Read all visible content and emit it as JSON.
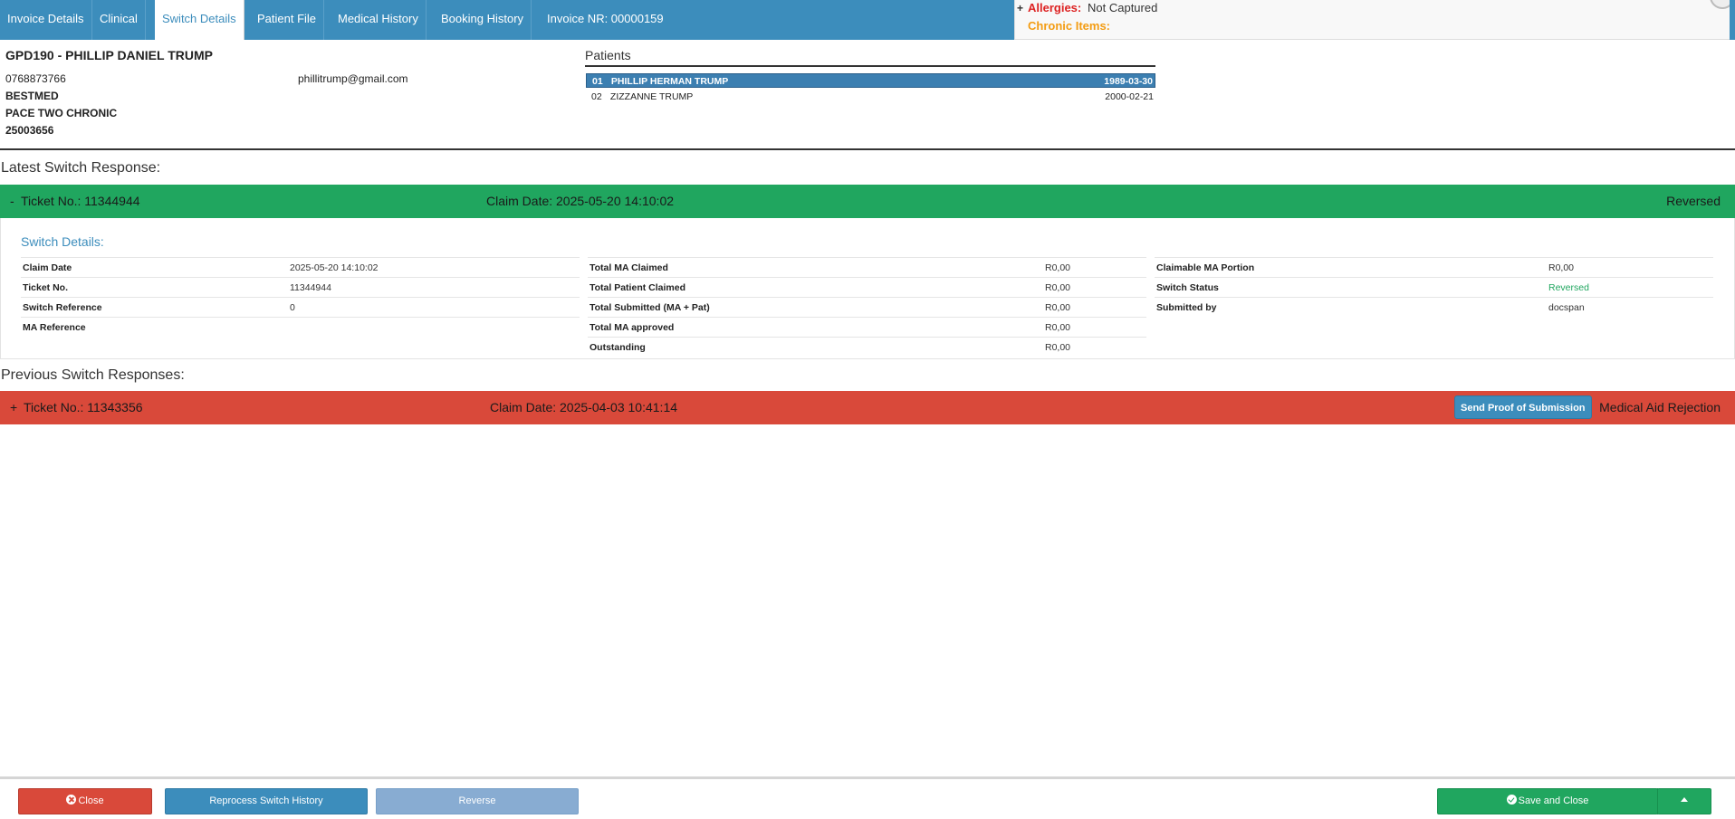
{
  "tabs": [
    {
      "label": "Invoice Details",
      "active": false
    },
    {
      "label": "Clinical",
      "active": false
    },
    {
      "label": "Switch Details",
      "active": true
    },
    {
      "label": "Patient File",
      "active": false
    },
    {
      "label": "Medical History",
      "active": false
    },
    {
      "label": "Booking History",
      "active": false
    }
  ],
  "invoice_nr": "Invoice NR: 00000159",
  "alerts": {
    "plus": "+",
    "allergies_label": "Allergies:",
    "allergies_value": "Not Captured",
    "chronic_label": "Chronic Items:"
  },
  "member": {
    "title": "GPD190 - PHILLIP DANIEL TRUMP",
    "phone": "0768873766",
    "email": "phillitrump@gmail.com",
    "scheme": "BESTMED",
    "plan": "PACE TWO CHRONIC",
    "number": "25003656"
  },
  "patients": {
    "title": "Patients",
    "rows": [
      {
        "num": "01",
        "name": "PHILLIP HERMAN TRUMP",
        "dob": "1989-03-30",
        "selected": true
      },
      {
        "num": "02",
        "name": "ZIZZANNE TRUMP",
        "dob": "2000-02-21",
        "selected": false
      }
    ]
  },
  "latest": {
    "heading": "Latest Switch Response:",
    "toggle": "-",
    "ticket": "Ticket No.: 11344944",
    "claim_date": "Claim Date: 2025-05-20 14:10:02",
    "status": "Reversed",
    "bar_color": "#20a65f"
  },
  "details": {
    "heading": "Switch Details:",
    "col1": [
      {
        "label": "Claim Date",
        "value": "2025-05-20 14:10:02"
      },
      {
        "label": "Ticket No.",
        "value": "11344944"
      },
      {
        "label": "Switch Reference",
        "value": "0"
      },
      {
        "label": "MA Reference",
        "value": ""
      }
    ],
    "col2": [
      {
        "label": "Total MA Claimed",
        "value": "R0,00"
      },
      {
        "label": "Total Patient Claimed",
        "value": "R0,00"
      },
      {
        "label": "Total Submitted (MA + Pat)",
        "value": "R0,00"
      },
      {
        "label": "Total MA approved",
        "value": "R0,00"
      },
      {
        "label": "Outstanding",
        "value": "R0,00"
      }
    ],
    "col3": [
      {
        "label": "Claimable MA Portion",
        "value": "R0,00"
      },
      {
        "label": "Switch Status",
        "value": "Reversed"
      },
      {
        "label": "Submitted by",
        "value": "docspan"
      }
    ],
    "status_color": "#20a65f"
  },
  "previous": {
    "heading": "Previous Switch Responses:",
    "items": [
      {
        "toggle": "+",
        "ticket": "Ticket No.: 11343356",
        "claim_date": "Claim Date: 2025-04-03 10:41:14",
        "proof_button": "Send Proof of Submission",
        "status": "Medical Aid Rejection",
        "bar_color": "#d9493a"
      }
    ]
  },
  "footer": {
    "close": "Close",
    "reprocess": "Reprocess Switch History",
    "reverse": "Reverse",
    "save_close": "Save and Close"
  },
  "icons": {
    "close": "close-circle-icon",
    "save": "check-circle-icon",
    "dropdown": "caret-up-icon"
  }
}
